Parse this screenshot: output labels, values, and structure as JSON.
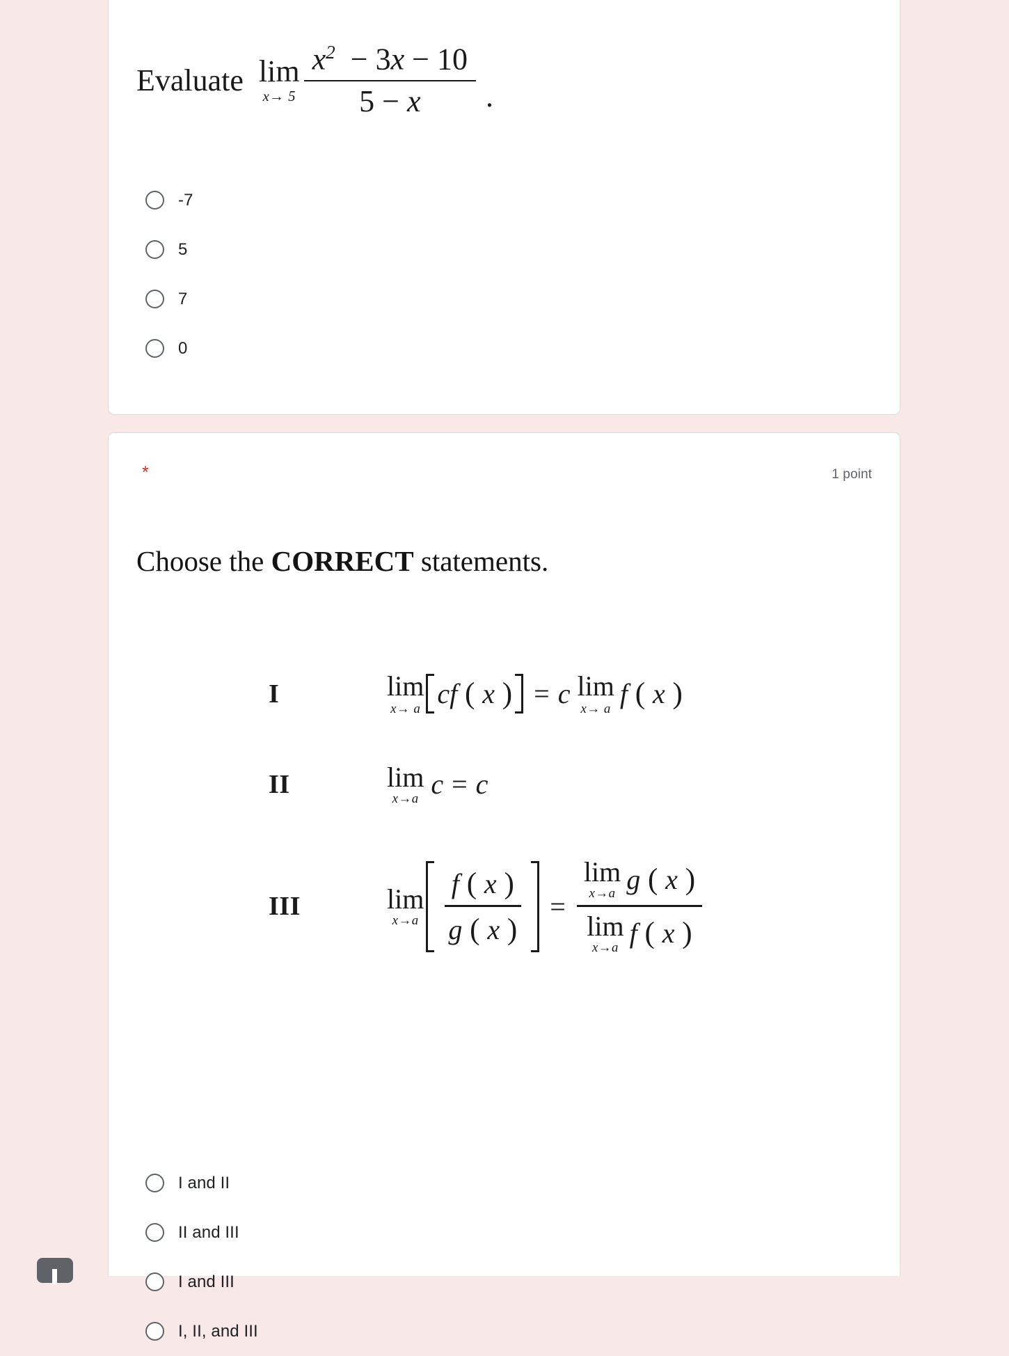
{
  "page": {
    "background_color": "#f9e8e8",
    "card_background": "#ffffff",
    "card_border_color": "#dadce0",
    "required_marker_color": "#d93025"
  },
  "questions": [
    {
      "id": "q1",
      "prompt_prefix": "Evaluate",
      "math": {
        "limit_operator": "lim",
        "limit_subscript": "x→ 5",
        "numerator_parts": [
          "x",
          "2",
          " − 3",
          "x",
          " − 10"
        ],
        "numerator_text": "x² − 3x − 10",
        "denominator_text": "5 − x",
        "trailing_punctuation": "."
      },
      "options": [
        {
          "label": "-7",
          "selected": false
        },
        {
          "label": "5",
          "selected": false
        },
        {
          "label": "7",
          "selected": false
        },
        {
          "label": "0",
          "selected": false
        }
      ]
    },
    {
      "id": "q2",
      "required_marker": "*",
      "point_value": "1 point",
      "heading": {
        "before": "Choose the ",
        "emphasis": "CORRECT",
        "after": " statements."
      },
      "statements": [
        {
          "numeral": "I",
          "expression_text": "lim x→a [ c f(x) ] = c lim x→a f(x)",
          "lhs": {
            "limit": "lim",
            "limit_sub": "x→ a",
            "bracket_content": "cf ( x )"
          },
          "relation": "=",
          "rhs": {
            "coefficient": "c",
            "limit": "lim",
            "limit_sub": "x→ a",
            "function": "f ( x )"
          }
        },
        {
          "numeral": "II",
          "expression_text": "lim x→a c = c",
          "lhs": {
            "limit": "lim",
            "limit_sub": "x→a",
            "body": "c"
          },
          "relation": "=",
          "rhs": {
            "value": "c"
          }
        },
        {
          "numeral": "III",
          "expression_text": "lim x→a [ f(x) / g(x) ] = lim x→a g(x) / lim x→a f(x)",
          "lhs": {
            "limit": "lim",
            "limit_sub": "x→a",
            "fraction_numerator": "f ( x )",
            "fraction_denominator": "g ( x )"
          },
          "relation": "=",
          "rhs": {
            "numerator": {
              "limit": "lim",
              "limit_sub": "x→a",
              "function": "g ( x )"
            },
            "denominator": {
              "limit": "lim",
              "limit_sub": "x→a",
              "function": "f ( x )"
            }
          }
        }
      ],
      "options": [
        {
          "label": "I and II",
          "selected": false
        },
        {
          "label": "II and III",
          "selected": false
        },
        {
          "label": "I and III",
          "selected": false
        },
        {
          "label": "I, II, and III",
          "selected": false
        }
      ]
    }
  ]
}
